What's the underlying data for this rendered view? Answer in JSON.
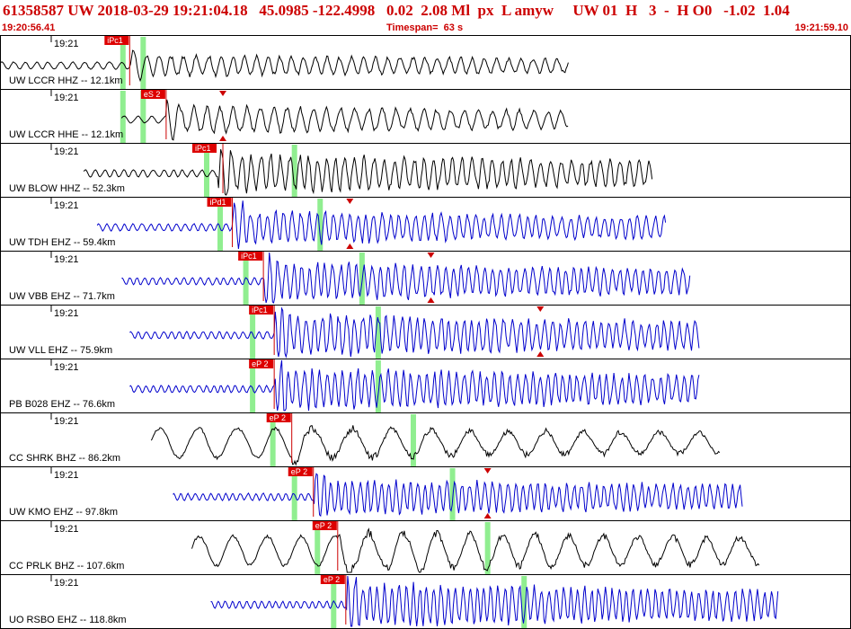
{
  "header": {
    "title": "61358587 UW 2018-03-29 19:21:04.18   45.0985 -122.4998   0.02  2.08 Ml  px  L amyw     UW 01  H   3  -  H O0   -1.02  1.04",
    "start_time": "19:20:56.41",
    "timespan": "Timespan=  63 s",
    "end_time": "19:21:59.10"
  },
  "colors": {
    "header_text": "#cc0000",
    "pick_box": "#dd0000",
    "pick_line": "#cc0000",
    "green_marker": "#90ee90",
    "trace_black": "#000000",
    "trace_blue": "#0000cc",
    "panel_border": "#000000"
  },
  "time_axis": {
    "start_seconds": 0,
    "span_seconds": 63
  },
  "panels": [
    {
      "label": "UW LCCR HHZ -- 12.1km",
      "time": "19:21",
      "color": "black",
      "pick": "iPc1",
      "pick_t": 9.6,
      "greens": [
        9.1,
        10.6
      ],
      "trace_start": 0.0,
      "trace_end": 42.1,
      "amp": 0.2,
      "freq": 1.1,
      "seed": 1,
      "pick_line_t": 9.6,
      "tri_t": null
    },
    {
      "label": "UW LCCR HHE -- 12.1km",
      "time": "19:21",
      "color": "black",
      "pick": "eS 2",
      "pick_t": 12.3,
      "greens": [
        9.1,
        10.6
      ],
      "trace_start": 9.0,
      "trace_end": 42.1,
      "amp": 0.25,
      "freq": 1.0,
      "seed": 2,
      "pick_line_t": 12.3,
      "tri_t": 16.5
    },
    {
      "label": "UW BLOW HHZ -- 52.3km",
      "time": "19:21",
      "color": "black",
      "pick": "iPc1",
      "pick_t": 16.1,
      "greens": [
        15.3,
        21.8
      ],
      "trace_start": 6.2,
      "trace_end": 48.3,
      "amp": 0.35,
      "freq": 1.4,
      "seed": 3,
      "pick_line_t": 16.5,
      "tri_t": null
    },
    {
      "label": "UW TDH EHZ -- 59.4km",
      "time": "19:21",
      "color": "blue",
      "pick": "iPd1",
      "pick_t": 17.2,
      "greens": [
        16.3,
        23.7
      ],
      "trace_start": 7.2,
      "trace_end": 49.3,
      "amp": 0.3,
      "freq": 1.6,
      "seed": 4,
      "pick_line_t": 17.2,
      "tri_t": 25.9
    },
    {
      "label": "UW VBB EHZ -- 71.7km",
      "time": "19:21",
      "color": "blue",
      "pick": "iPc1",
      "pick_t": 19.5,
      "greens": [
        18.2,
        26.8
      ],
      "trace_start": 9.0,
      "trace_end": 51.1,
      "amp": 0.35,
      "freq": 1.7,
      "seed": 5,
      "pick_line_t": 19.5,
      "tri_t": 31.9
    },
    {
      "label": "UW VLL EHZ -- 75.9km",
      "time": "19:21",
      "color": "blue",
      "pick": "iPc1",
      "pick_t": 20.3,
      "greens": [
        18.7,
        28.0
      ],
      "trace_start": 9.6,
      "trace_end": 51.8,
      "amp": 0.38,
      "freq": 1.7,
      "seed": 6,
      "pick_line_t": 20.3,
      "tri_t": 40.0
    },
    {
      "label": "PB B028 EHZ -- 76.6km",
      "time": "19:21",
      "color": "blue",
      "pick": "eP 2",
      "pick_t": 20.3,
      "greens": [
        18.7,
        28.0
      ],
      "trace_start": 9.6,
      "trace_end": 51.8,
      "amp": 0.38,
      "freq": 1.8,
      "seed": 7,
      "pick_line_t": 20.3,
      "tri_t": null
    },
    {
      "label": "CC SHRK BHZ -- 86.2km",
      "time": "19:21",
      "color": "black",
      "pick": "eP 2",
      "pick_t": 21.6,
      "greens": [
        20.2,
        30.6
      ],
      "trace_start": 11.2,
      "trace_end": 53.3,
      "amp": 0.3,
      "freq": 0.35,
      "seed": 8,
      "pick_line_t": 21.6,
      "tri_t": null
    },
    {
      "label": "UW KMO EHZ -- 97.8km",
      "time": "19:21",
      "color": "blue",
      "pick": "eP 2",
      "pick_t": 23.2,
      "greens": [
        21.8,
        33.5
      ],
      "trace_start": 12.8,
      "trace_end": 55.0,
      "amp": 0.33,
      "freq": 1.8,
      "seed": 9,
      "pick_line_t": 23.2,
      "tri_t": 36.1
    },
    {
      "label": "CC PRLK BHZ -- 107.6km",
      "time": "19:21",
      "color": "black",
      "pick": "eP 2",
      "pick_t": 25.0,
      "greens": [
        23.5,
        36.1
      ],
      "trace_start": 14.2,
      "trace_end": 56.2,
      "amp": 0.38,
      "freq": 0.4,
      "seed": 10,
      "pick_line_t": 25.0,
      "tri_t": null
    },
    {
      "label": "UO RSBO EHZ -- 118.8km",
      "time": "19:21",
      "color": "blue",
      "pick": "eP 2",
      "pick_t": 25.6,
      "greens": [
        24.7,
        38.8
      ],
      "trace_start": 15.6,
      "trace_end": 57.6,
      "amp": 0.4,
      "freq": 1.9,
      "seed": 11,
      "pick_line_t": 25.6,
      "tri_t": null
    }
  ]
}
